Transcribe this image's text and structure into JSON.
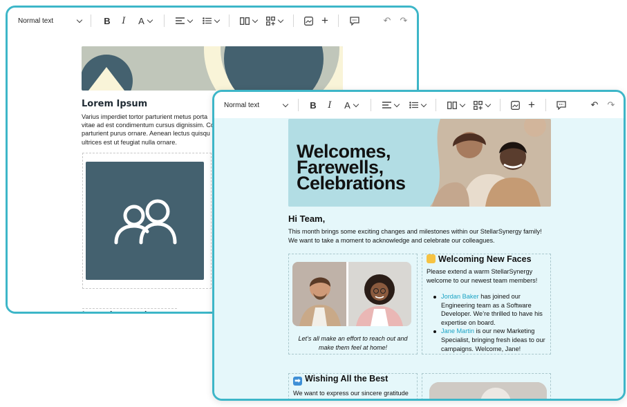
{
  "back_window": {
    "toolbar": {
      "text_style": "Normal text",
      "bold": "B",
      "italic": "I",
      "text_color": "A"
    },
    "title": "Lorem Ipsum",
    "paragraph": "Varius imperdiet tortor parturient metus porta\nvitae ad est condimentum cursus dignissim. Co\nparturient purus ornare. Aenean lectus quisqu\nultrices est ut feugiat nulla ornare.",
    "next_heading": "Lorem ipsum odor amet"
  },
  "front_window": {
    "toolbar": {
      "text_style": "Normal text",
      "bold": "B",
      "italic": "I",
      "text_color": "A"
    },
    "hero_title": "Welcomes, Farewells, Celebrations",
    "greeting": "Hi Team,",
    "intro": "This month brings some exciting changes and milestones within our StellarSynergy family!\nWe want to take a moment to acknowledge and celebrate our colleagues.",
    "photo_caption": "Let’s all make an effort to reach out and\nmake them feel at home!",
    "welcoming": {
      "heading": "Welcoming New Faces",
      "intro": "Please extend a warm StellarSynergy\nwelcome to our newest team members!",
      "members": [
        {
          "name": "Jordan Baker",
          "text": " has joined our\nEngineering team as a Software\nDeveloper. We’re thrilled to have his\nexpertise on board."
        },
        {
          "name": "Jane Martin",
          "text": " is our new Marketing\nSpecialist, bringing fresh ideas to our\ncampaigns. Welcome, Jane!"
        }
      ]
    },
    "wishing": {
      "heading": "Wishing All the Best",
      "text": "We want to express our sincere gratitude"
    }
  },
  "colors": {
    "window_border": "#3db6c8",
    "doc_background": "#e5f7fa",
    "hero_background": "#b2dde4",
    "link": "#1aa3c4",
    "slate": "#44616f"
  },
  "icons": [
    "chevron-down-icon",
    "align-left-icon",
    "bullet-list-icon",
    "columns-icon",
    "add-block-icon",
    "image-icon",
    "plus-icon",
    "comment-icon",
    "undo-icon",
    "redo-icon",
    "users-icon",
    "waving-hand-icon",
    "right-arrow-icon"
  ]
}
